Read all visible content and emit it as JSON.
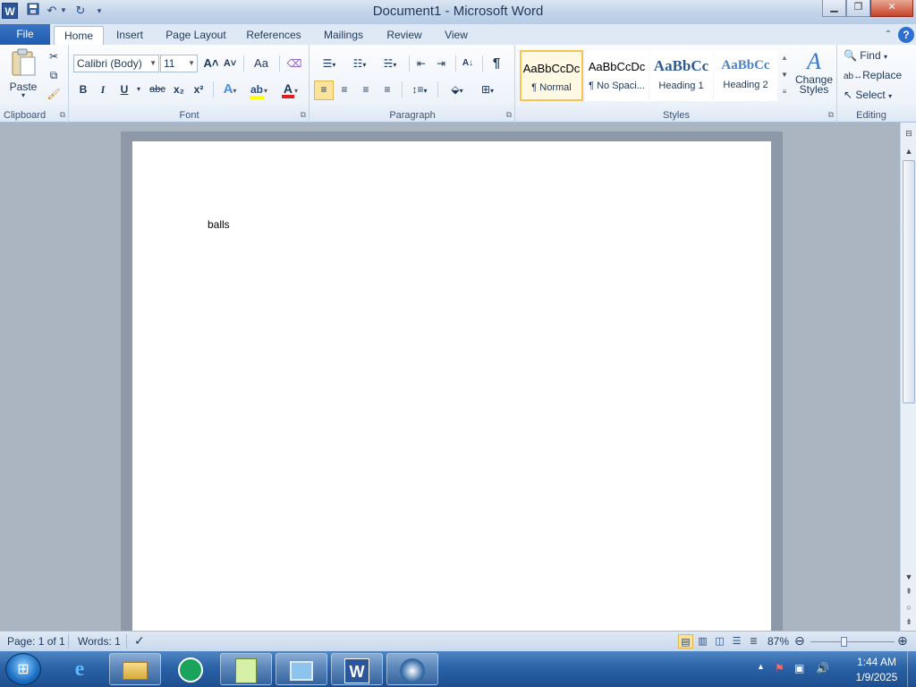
{
  "window": {
    "title": "Document1  -  Microsoft Word",
    "app_icon": "W",
    "qat": {
      "save_icon": "save-icon",
      "undo_icon": "undo-icon",
      "redo_icon": "redo-icon",
      "customize_icon": "customize-qat-icon"
    }
  },
  "tabs": {
    "file": "File",
    "items": [
      "Home",
      "Insert",
      "Page Layout",
      "References",
      "Mailings",
      "Review",
      "View"
    ],
    "active": "Home"
  },
  "ribbon": {
    "clipboard": {
      "label": "Clipboard",
      "paste": "Paste"
    },
    "font": {
      "label": "Font",
      "font_name": "Calibri (Body)",
      "font_size": "11",
      "bold": "B",
      "italic": "I",
      "underline": "U",
      "strike": "abc",
      "subscript": "x₂",
      "superscript": "x²",
      "grow": "A˄",
      "shrink": "A˅",
      "change_case": "Aa"
    },
    "paragraph": {
      "label": "Paragraph",
      "pilcrow": "¶"
    },
    "styles": {
      "label": "Styles",
      "items": [
        {
          "sample": "AaBbCcDc",
          "name": "¶ Normal",
          "selected": true
        },
        {
          "sample": "AaBbCcDc",
          "name": "¶ No Spaci...",
          "selected": false
        },
        {
          "sample": "AaBbCc",
          "name": "Heading 1",
          "selected": false
        },
        {
          "sample": "AaBbCc",
          "name": "Heading 2",
          "selected": false
        }
      ],
      "change_styles_line1": "Change",
      "change_styles_line2": "Styles"
    },
    "editing": {
      "label": "Editing",
      "find": "Find",
      "replace": "Replace",
      "select": "Select"
    }
  },
  "document": {
    "text": "balls"
  },
  "statusbar": {
    "page": "Page: 1 of 1",
    "words": "Words: 1",
    "zoom": "87%",
    "zoom_fraction": 0.4
  },
  "taskbar": {
    "time": "1:44 AM",
    "date": "1/9/2025"
  },
  "colors": {
    "accent": "#2b579a",
    "file_tab": "#2a66b9",
    "highlight": "#f3c456",
    "font_color": "#e02020",
    "highlighter": "#ffff00"
  }
}
